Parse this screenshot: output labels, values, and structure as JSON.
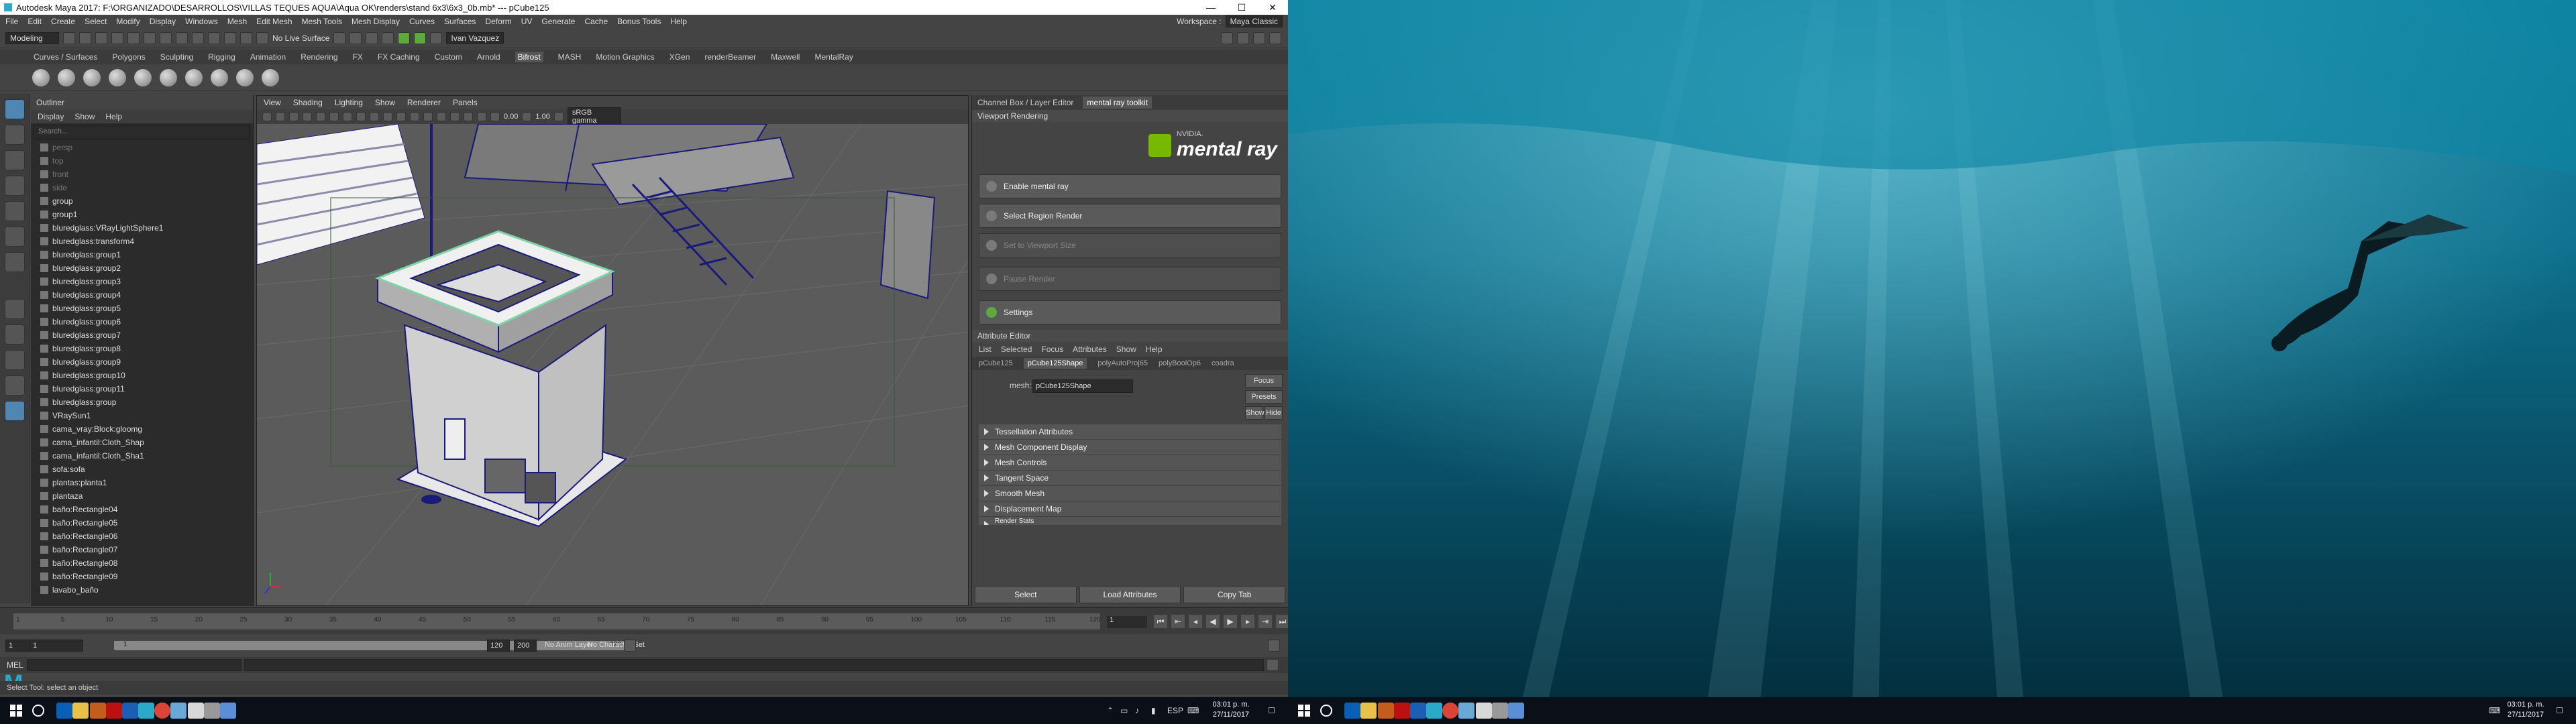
{
  "window": {
    "title": "Autodesk Maya 2017: F:\\ORGANIZADO\\DESARROLLOS\\VILLAS TEQUES AQUA\\Aqua OK\\renders\\stand 6x3\\6x3_0b.mb* --- pCube125"
  },
  "menubar": {
    "items": [
      "File",
      "Edit",
      "Create",
      "Select",
      "Modify",
      "Display",
      "Windows",
      "Mesh",
      "Edit Mesh",
      "Mesh Tools",
      "Mesh Display",
      "Curves",
      "Surfaces",
      "Deform",
      "UV",
      "Generate",
      "Cache",
      "Bonus Tools",
      "Help"
    ],
    "workspace_label": "Workspace :",
    "workspace_value": "Maya Classic"
  },
  "statusline": {
    "mode": "Modeling",
    "live_surface": "No Live Surface",
    "user": "Ivan Vazquez"
  },
  "shelf": {
    "tabs": [
      "Curves / Surfaces",
      "Polygons",
      "Sculpting",
      "Rigging",
      "Animation",
      "Rendering",
      "FX",
      "FX Caching",
      "Custom",
      "Arnold",
      "Bifrost",
      "MASH",
      "Motion Graphics",
      "XGen",
      "renderBeamer",
      "Maxwell",
      "MentalRay"
    ],
    "active_tab": "Bifrost"
  },
  "outliner": {
    "title": "Outliner",
    "menu": [
      "Display",
      "Show",
      "Help"
    ],
    "search_placeholder": "Search...",
    "items": [
      {
        "label": "persp",
        "dim": true
      },
      {
        "label": "top",
        "dim": true
      },
      {
        "label": "front",
        "dim": true
      },
      {
        "label": "side",
        "dim": true
      },
      {
        "label": "group",
        "dim": false
      },
      {
        "label": "group1",
        "dim": false
      },
      {
        "label": "bluredglass:VRayLightSphere1",
        "dim": false
      },
      {
        "label": "bluredglass:transform4",
        "dim": false
      },
      {
        "label": "bluredglass:group1",
        "dim": false
      },
      {
        "label": "bluredglass:group2",
        "dim": false
      },
      {
        "label": "bluredglass:group3",
        "dim": false
      },
      {
        "label": "bluredglass:group4",
        "dim": false
      },
      {
        "label": "bluredglass:group5",
        "dim": false
      },
      {
        "label": "bluredglass:group6",
        "dim": false
      },
      {
        "label": "bluredglass:group7",
        "dim": false
      },
      {
        "label": "bluredglass:group8",
        "dim": false
      },
      {
        "label": "bluredglass:group9",
        "dim": false
      },
      {
        "label": "bluredglass:group10",
        "dim": false
      },
      {
        "label": "bluredglass:group11",
        "dim": false
      },
      {
        "label": "bluredglass:group",
        "dim": false
      },
      {
        "label": "VRaySun1",
        "dim": false
      },
      {
        "label": "cama_vray:Block:gloomg",
        "dim": false
      },
      {
        "label": "cama_infantil:Cloth_Shap",
        "dim": false
      },
      {
        "label": "cama_infantil:Cloth_Sha1",
        "dim": false
      },
      {
        "label": "sofa:sofa",
        "dim": false
      },
      {
        "label": "plantas:planta1",
        "dim": false
      },
      {
        "label": "plantaza",
        "dim": false
      },
      {
        "label": "baño:Rectangle04",
        "dim": false
      },
      {
        "label": "baño:Rectangle05",
        "dim": false
      },
      {
        "label": "baño:Rectangle06",
        "dim": false
      },
      {
        "label": "baño:Rectangle07",
        "dim": false
      },
      {
        "label": "baño:Rectangle08",
        "dim": false
      },
      {
        "label": "baño:Rectangle09",
        "dim": false
      },
      {
        "label": "lavabo_baño",
        "dim": false
      }
    ]
  },
  "viewport": {
    "menu": [
      "View",
      "Shading",
      "Lighting",
      "Show",
      "Renderer",
      "Panels"
    ],
    "near_value": "0.00",
    "far_value": "1.00",
    "color_space": "sRGB gamma"
  },
  "right_panel": {
    "tabs": [
      "Channel Box / Layer Editor",
      "mental ray toolkit"
    ],
    "active_tab": "mental ray toolkit",
    "mr_header": "Viewport Rendering",
    "logo_nvidia": "NVIDIA.",
    "logo_text": "mental ray",
    "buttons": [
      {
        "label": "Enable mental ray",
        "disabled": false
      },
      {
        "label": "Select Region Render",
        "disabled": false
      },
      {
        "label": "Set to Viewport Size",
        "disabled": true
      },
      {
        "label": "Pause Render",
        "disabled": true
      },
      {
        "label": "Settings",
        "disabled": false
      }
    ],
    "ae_title": "Attribute Editor",
    "ae_menu": [
      "List",
      "Selected",
      "Focus",
      "Attributes",
      "Show",
      "Help"
    ],
    "ae_tabs": [
      "pCube125",
      "pCube125Shape",
      "polyAutoProj65",
      "polyBoolOp6",
      "coadra"
    ],
    "ae_active_tab": "pCube125Shape",
    "mesh_label": "mesh:",
    "mesh_value": "pCube125Shape",
    "focus_btn": "Focus",
    "presets_btn": "Presets",
    "show_btn": "Show",
    "hide_btn": "Hide",
    "sections": [
      "Tessellation Attributes",
      "Mesh Component Display",
      "Mesh Controls",
      "Tangent Space",
      "Smooth Mesh",
      "Displacement Map",
      "Render Stats"
    ],
    "bottom_buttons": [
      "Select",
      "Load Attributes",
      "Copy Tab"
    ]
  },
  "timeline": {
    "ticks": [
      "1",
      "5",
      "10",
      "15",
      "20",
      "25",
      "30",
      "35",
      "40",
      "45",
      "50",
      "55",
      "60",
      "65",
      "70",
      "75",
      "80",
      "85",
      "90",
      "95",
      "100",
      "105",
      "110",
      "115",
      "120"
    ],
    "current_frame": "1"
  },
  "range": {
    "start": "1",
    "inner_start": "1",
    "slider_start": "1",
    "slider_end": "120",
    "end_inner": "120",
    "end": "200",
    "anim_layer": "No Anim Layer",
    "char_set": "No Character Set"
  },
  "cmd": {
    "label": "MEL"
  },
  "help_line": "Select Tool: select an object",
  "taskbar": {
    "lang": "ESP",
    "time": "03:01 p. m.",
    "date": "27/11/2017"
  }
}
